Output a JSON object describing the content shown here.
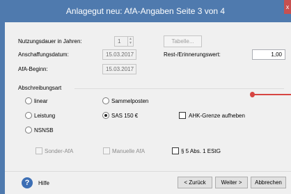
{
  "window": {
    "title": "Anlagegut neu: AfA-Angaben Seite 3 von 4",
    "close": "x"
  },
  "fields": {
    "nutzungsdauer_label": "Nutzungsdauer in Jahren:",
    "nutzungsdauer_value": "1",
    "tabelle_button": "Tabelle...",
    "anschaffungsdatum_label": "Anschaffungsdatum:",
    "anschaffungsdatum_value": "15.03.2017",
    "rest_label": "Rest-/Erinnerungswert:",
    "rest_value": "1,00",
    "afa_beginn_label": "AfA-Beginn:",
    "afa_beginn_value": "15.03.2017"
  },
  "abschreibungsart": {
    "group_label": "Abschreibungsart",
    "options": [
      "linear",
      "Sammelposten",
      "Leistung",
      "SAS 150 €",
      "NSNSB"
    ],
    "selected": "SAS 150 €",
    "ahk_label": "AHK-Grenze aufheben"
  },
  "extras": {
    "sonder_afa": "Sonder-AfA",
    "manuelle_afa": "Manuelle AfA",
    "estg": "§ 5 Abs. 1 EStG"
  },
  "footer": {
    "help_label": "Hilfe",
    "back": "< Zurück",
    "next": "Weiter >",
    "cancel": "Abbrechen"
  },
  "colors": {
    "titlebar": "#4f7aae",
    "annotation_arrow": "#d64542"
  }
}
